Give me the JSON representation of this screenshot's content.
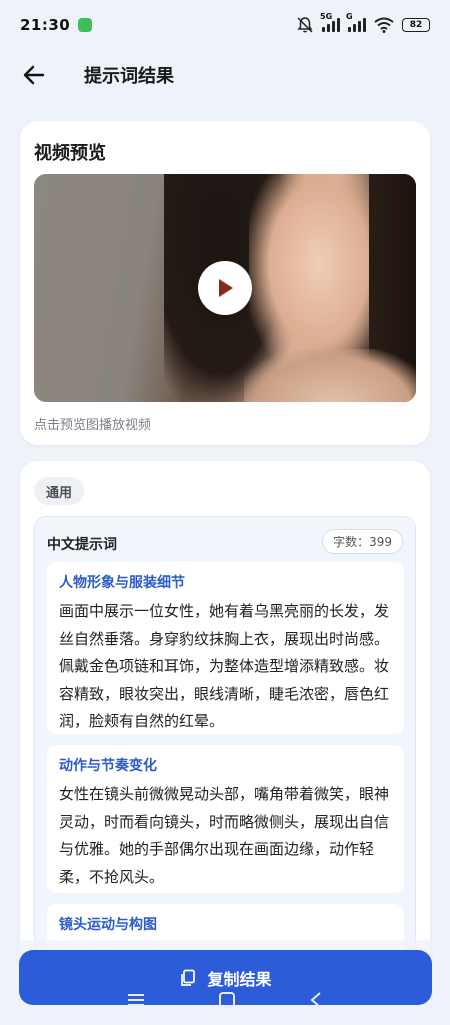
{
  "status_bar": {
    "time": "21:30",
    "network_1": "5G",
    "network_2": "G",
    "battery": "82",
    "icons": [
      "app-notification-icon",
      "mute-bell-icon",
      "signal-icon",
      "wifi-icon",
      "battery-icon"
    ]
  },
  "header": {
    "title": "提示词结果",
    "back_icon": "back-arrow-icon"
  },
  "preview": {
    "title": "视频预览",
    "hint": "点击预览图播放视频",
    "play_icon": "play-icon"
  },
  "result": {
    "tag": "通用",
    "inner_title": "中文提示词",
    "count": "字数：399",
    "sections": [
      {
        "title": "人物形象与服装细节",
        "body": "画面中展示一位女性，她有着乌黑亮丽的长发，发丝自然垂落。身穿豹纹抹胸上衣，展现出时尚感。佩戴金色项链和耳饰，为整体造型增添精致感。妆容精致，眼妆突出，眼线清晰，睫毛浓密，唇色红润，脸颊有自然的红晕。"
      },
      {
        "title": "动作与节奏变化",
        "body": "女性在镜头前微微晃动头部，嘴角带着微笑，眼神灵动，时而看向镜头，时而略微侧头，展现出自信与优雅。她的手部偶尔出现在画面边缘，动作轻柔，不抢风头。"
      },
      {
        "title": "镜头运动与构图",
        "body": ""
      }
    ]
  },
  "actions": {
    "copy_label": "复制结果",
    "copy_icon": "copy-icon"
  },
  "colors": {
    "accent": "#2d5cd8",
    "section_title": "#2d5cc6",
    "background": "#eef2f9"
  }
}
